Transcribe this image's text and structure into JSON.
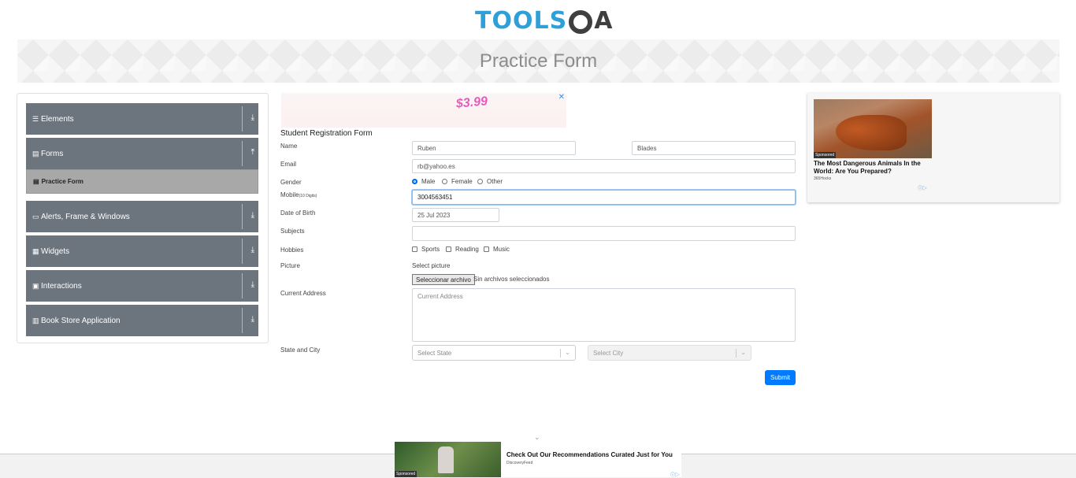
{
  "logo": {
    "part1": "TOOLS",
    "part2": "A"
  },
  "page": {
    "title": "Practice Form"
  },
  "sidebar": {
    "groups": [
      {
        "label": "Elements",
        "icon": "hamburger-icon",
        "arrow": "down"
      },
      {
        "label": "Forms",
        "icon": "file-icon",
        "arrow": "up"
      },
      {
        "label": "Alerts, Frame & Windows",
        "icon": "window-icon",
        "arrow": "down"
      },
      {
        "label": "Widgets",
        "icon": "grid-icon",
        "arrow": "down"
      },
      {
        "label": "Interactions",
        "icon": "interaction-icon",
        "arrow": "down"
      },
      {
        "label": "Book Store Application",
        "icon": "book-icon",
        "arrow": "down"
      }
    ],
    "active_item": "Practice Form"
  },
  "ads": {
    "top_price": "$3.99",
    "right": {
      "sponsored": "Sponsored",
      "headline": "The Most Dangerous Animals In the World: Are You Prepared?",
      "source": "365Hocks"
    },
    "bottom": {
      "sponsored": "Sponsored",
      "headline": "Check Out Our Recommendations Curated Just for You",
      "source": "DiscoveryFeed"
    }
  },
  "form": {
    "title": "Student Registration Form",
    "labels": {
      "name": "Name",
      "email": "Email",
      "gender": "Gender",
      "mobile": "Mobile",
      "mobile_hint": "(10 Digits)",
      "dob": "Date of Birth",
      "subjects": "Subjects",
      "hobbies": "Hobbies",
      "picture": "Picture",
      "address": "Current Address",
      "state_city": "State and City"
    },
    "first_name": "Ruben",
    "last_name": "Blades",
    "email": "rb@yahoo.es",
    "gender_options": [
      "Male",
      "Female",
      "Other"
    ],
    "gender_selected": "Male",
    "mobile": "3004563451",
    "dob": "25 Jul 2023",
    "subjects": "",
    "hobbies": [
      "Sports",
      "Reading",
      "Music"
    ],
    "picture_label": "Select picture",
    "file_button": "Seleccionar archivo",
    "file_status": "Sin archivos seleccionados",
    "address_placeholder": "Current Address",
    "state_placeholder": "Select State",
    "city_placeholder": "Select City",
    "submit": "Submit"
  }
}
